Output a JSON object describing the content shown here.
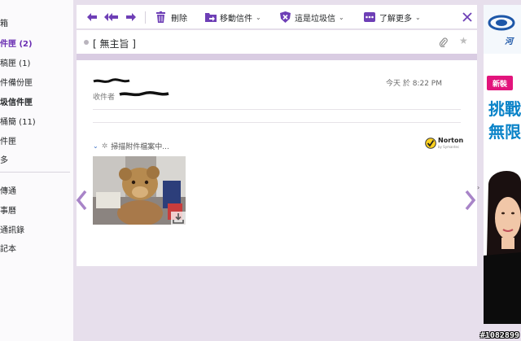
{
  "sidebar": {
    "items": [
      {
        "label": "箱",
        "active": false,
        "bold": false
      },
      {
        "label": "件匣 (2)",
        "active": true,
        "bold": false
      },
      {
        "label": "稿匣 (1)",
        "active": false,
        "bold": false
      },
      {
        "label": "件備份匣",
        "active": false,
        "bold": false
      },
      {
        "label": "圾信件匣",
        "active": false,
        "bold": true
      },
      {
        "label": "桶簡 (11)",
        "active": false,
        "bold": false
      },
      {
        "label": "件匣",
        "active": false,
        "bold": false
      },
      {
        "label": "多",
        "active": false,
        "bold": false
      },
      {
        "label": "傳通",
        "active": false,
        "bold": false
      },
      {
        "label": "事曆",
        "active": false,
        "bold": false
      },
      {
        "label": "通訊錄",
        "active": false,
        "bold": false
      },
      {
        "label": "記本",
        "active": false,
        "bold": false
      }
    ]
  },
  "toolbar": {
    "delete_label": "刪除",
    "move_label": "移動信件",
    "spam_label": "這是垃圾信",
    "more_label": "了解更多",
    "colors": {
      "accent": "#6b2fb3",
      "icon": "#6e3fb6"
    }
  },
  "message": {
    "subject": "[ 無主旨 ]",
    "recipient_label": "收件者",
    "timestamp": "今天 於  8:22 PM",
    "scan_text": "掃描附件檔案中...",
    "norton_label": "Norton",
    "norton_sub": "by Symantec"
  },
  "ad": {
    "logo_text": "河",
    "badge": "新裝",
    "headline1": "挑戰",
    "headline2": "無限"
  },
  "watermark": "#1082899"
}
